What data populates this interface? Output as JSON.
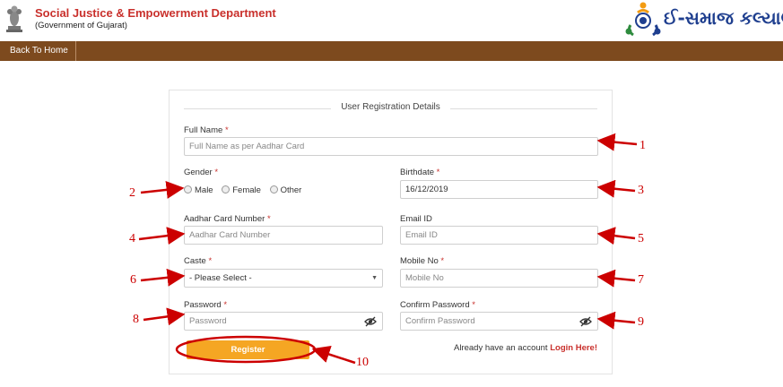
{
  "header": {
    "title": "Social Justice & Empowerment Department",
    "subtitle": "(Government of Gujarat)",
    "logo_text": "ઈ-સમાજ કલ્યાણ"
  },
  "nav": {
    "back_label": "Back To Home"
  },
  "form": {
    "legend": "User Registration Details",
    "full_name": {
      "label": "Full Name",
      "placeholder": "Full Name as per Aadhar Card"
    },
    "gender": {
      "label": "Gender",
      "options": [
        "Male",
        "Female",
        "Other"
      ]
    },
    "birthdate": {
      "label": "Birthdate",
      "value": "16/12/2019"
    },
    "aadhar": {
      "label": "Aadhar Card Number",
      "placeholder": "Aadhar Card Number"
    },
    "email": {
      "label": "Email ID",
      "placeholder": "Email ID"
    },
    "caste": {
      "label": "Caste",
      "selected": "- Please Select -"
    },
    "mobile": {
      "label": "Mobile No",
      "placeholder": "Mobile No"
    },
    "password": {
      "label": "Password",
      "placeholder": "Password"
    },
    "confirm_password": {
      "label": "Confirm Password",
      "placeholder": "Confirm Password"
    },
    "register_label": "Register",
    "already_text": "Already have an account",
    "login_label": "Login Here!"
  },
  "annotations": [
    "1",
    "2",
    "3",
    "4",
    "5",
    "6",
    "7",
    "8",
    "9",
    "10"
  ],
  "colors": {
    "accent_red": "#c9302c",
    "nav_brown": "#7d4a1e",
    "register_orange": "#f5a623",
    "annotation_red": "#cc0000"
  }
}
